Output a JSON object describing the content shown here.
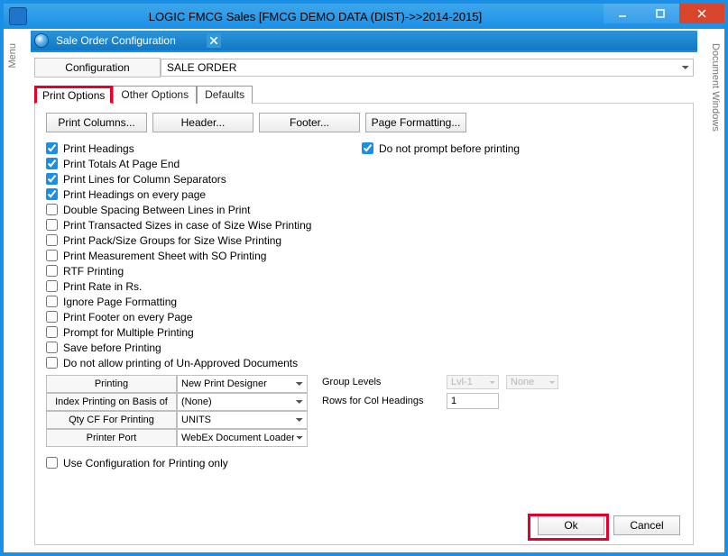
{
  "window": {
    "title": "LOGIC FMCG Sales  [FMCG DEMO DATA (DIST)->>2014-2015]"
  },
  "side_tabs": {
    "left": "Menu",
    "right": "Document Windows"
  },
  "inner_tab": {
    "title": "Sale Order Configuration"
  },
  "config": {
    "label": "Configuration",
    "value": "SALE ORDER"
  },
  "sub_tabs": {
    "print_options": "Print Options",
    "other_options": "Other Options",
    "defaults": "Defaults"
  },
  "buttons": {
    "print_columns": "Print Columns...",
    "header": "Header...",
    "footer": "Footer...",
    "page_formatting": "Page Formatting..."
  },
  "checks_left": [
    {
      "label": "Print Headings",
      "checked": true
    },
    {
      "label": "Print Totals At Page End",
      "checked": true
    },
    {
      "label": "Print Lines for Column Separators",
      "checked": true
    },
    {
      "label": "Print Headings on every page",
      "checked": true
    },
    {
      "label": "Double Spacing Between Lines in Print",
      "checked": false
    },
    {
      "label": "Print Transacted Sizes in case of Size Wise Printing",
      "checked": false
    },
    {
      "label": "Print Pack/Size Groups for Size Wise Printing",
      "checked": false
    },
    {
      "label": "Print Measurement Sheet with SO Printing",
      "checked": false
    },
    {
      "label": "RTF Printing",
      "checked": false
    },
    {
      "label": "Print Rate in Rs.",
      "checked": false
    },
    {
      "label": "Ignore Page Formatting",
      "checked": false
    },
    {
      "label": "Print Footer on every Page",
      "checked": false
    },
    {
      "label": "Prompt for Multiple Printing",
      "checked": false
    },
    {
      "label": "Save before Printing",
      "checked": false
    },
    {
      "label": "Do not allow printing of Un-Approved Documents",
      "checked": false
    }
  ],
  "check_right": {
    "label": "Do not prompt before printing",
    "checked": true
  },
  "dropdowns": {
    "printing": {
      "label": "Printing",
      "value": "New Print Designer"
    },
    "index_printing": {
      "label": "Index Printing on Basis of",
      "value": "(None)"
    },
    "qty_cf": {
      "label": "Qty CF For Printing",
      "value": "UNITS"
    },
    "printer_port": {
      "label": "Printer Port",
      "value": "WebEx Document Loader"
    }
  },
  "right_panel": {
    "group_levels_label": "Group Levels",
    "group_levels_value1": "Lvl-1",
    "group_levels_value2": "None",
    "rows_label": "Rows for Col Headings",
    "rows_value": "1"
  },
  "bottom_check": {
    "label": "Use Configuration for Printing only",
    "checked": false
  },
  "footer": {
    "ok": "Ok",
    "cancel": "Cancel"
  }
}
